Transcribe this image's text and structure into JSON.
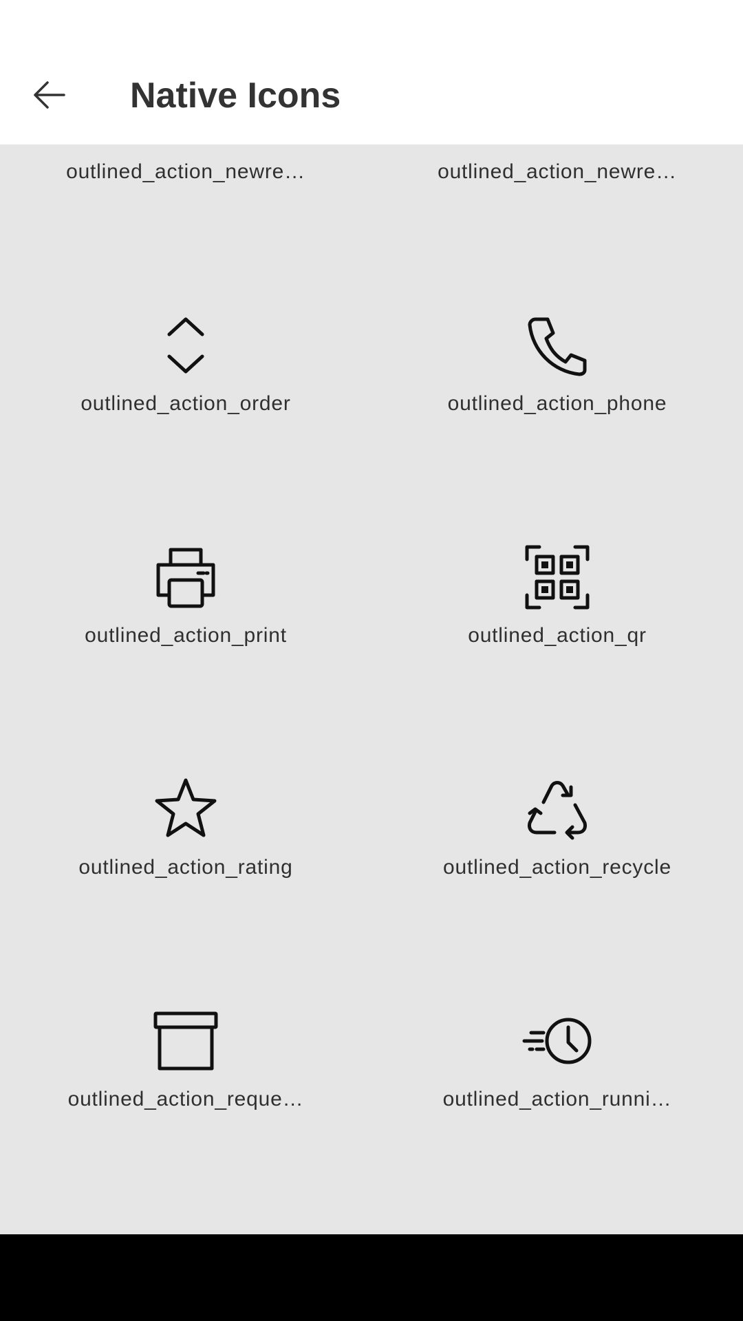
{
  "app_bar": {
    "title": "Native Icons",
    "back_icon": "arrow-left-icon"
  },
  "icons": [
    {
      "label": "outlined_action_newre…",
      "icon": "new-request-edit-icon"
    },
    {
      "label": "outlined_action_newre…",
      "icon": "new-request-add-icon"
    },
    {
      "label": "outlined_action_order",
      "icon": "order-chevrons-icon"
    },
    {
      "label": "outlined_action_phone",
      "icon": "phone-icon"
    },
    {
      "label": "outlined_action_print",
      "icon": "printer-icon"
    },
    {
      "label": "outlined_action_qr",
      "icon": "qr-code-icon"
    },
    {
      "label": "outlined_action_rating",
      "icon": "star-icon"
    },
    {
      "label": "outlined_action_recycle",
      "icon": "recycle-icon"
    },
    {
      "label": "outlined_action_reque…",
      "icon": "archive-box-icon"
    },
    {
      "label": "outlined_action_runni…",
      "icon": "running-clock-icon"
    }
  ],
  "colors": {
    "app_bar_bg": "#ffffff",
    "content_bg": "#e6e6e6",
    "title_text": "#333333",
    "icon_stroke": "#111111",
    "nav_bar": "#000000"
  }
}
